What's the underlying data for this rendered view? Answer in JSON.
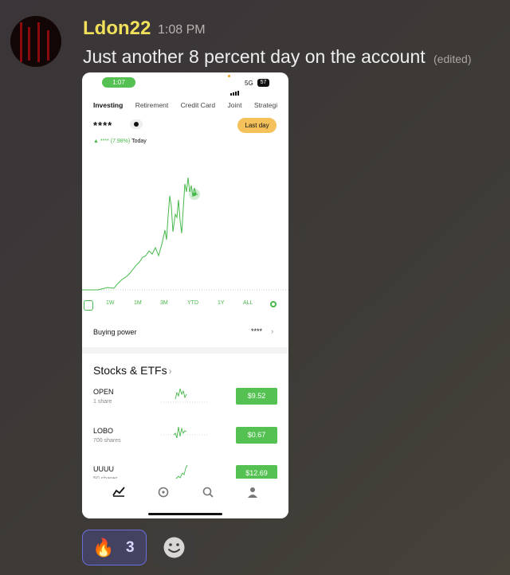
{
  "message": {
    "username": "Ldon22",
    "time": "1:08 PM",
    "text": "Just another 8 percent day on the account",
    "edited_tag": "(edited)"
  },
  "screenshot": {
    "status_time": "1:07",
    "network": "5G",
    "battery": "57",
    "tabs": [
      "Investing",
      "Retirement",
      "Credit Card",
      "Joint",
      "Strategi"
    ],
    "masked_value": "****",
    "last_day_button": "Last day",
    "gain_arrow": "▲",
    "gain_text": "**** (7.98%)",
    "gain_period": "Today",
    "ranges": [
      "1W",
      "1M",
      "3M",
      "YTD",
      "1Y",
      "ALL"
    ],
    "buying_power_label": "Buying power",
    "buying_power_value": "****",
    "section_title": "Stocks & ETFs",
    "stocks": [
      {
        "symbol": "OPEN",
        "shares": "1 share",
        "price": "$9.52"
      },
      {
        "symbol": "LOBO",
        "shares": "700 shares",
        "price": "$0.67"
      },
      {
        "symbol": "UUUU",
        "shares": "50 shares",
        "price": "$12.69"
      }
    ],
    "nav": [
      "chart-nav-icon",
      "compass-nav-icon",
      "search-nav-icon",
      "profile-nav-icon"
    ]
  },
  "reactions": {
    "emoji": "🔥",
    "count": "3",
    "add_reaction_icon": "smiley-icon"
  },
  "colors": {
    "username": "#f1e05a",
    "gain_green": "#46b84a",
    "price_pill": "#55c152",
    "last_day_pill": "#f5c15b",
    "reaction_border": "#6b6cdb"
  }
}
